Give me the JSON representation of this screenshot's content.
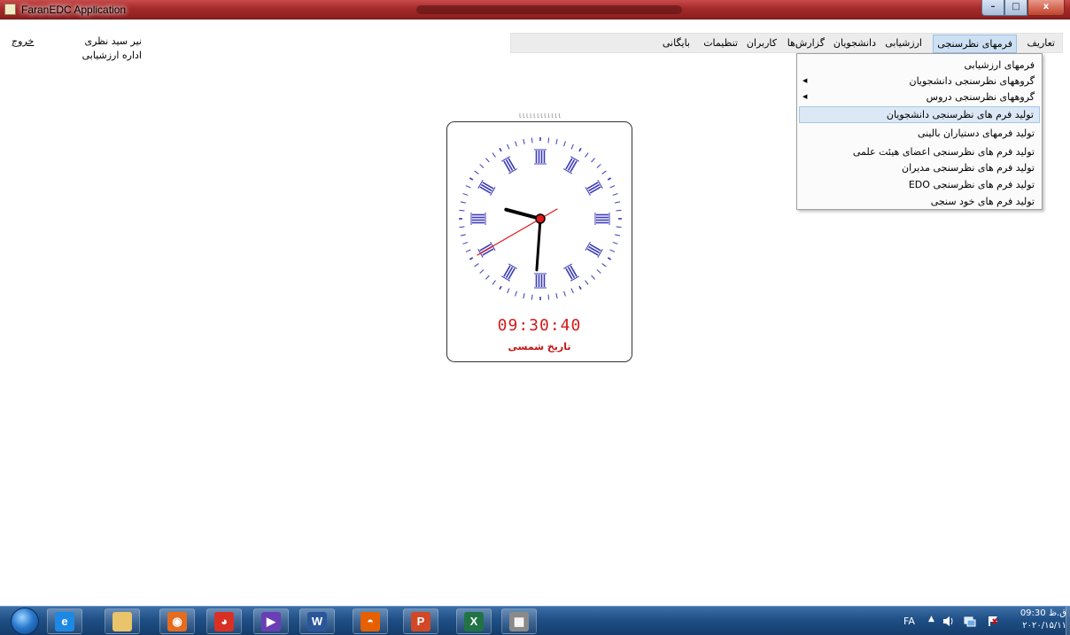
{
  "window": {
    "title": "FaranEDC Application",
    "buttons": {
      "minimize": "–",
      "maximize": "□",
      "close": "x"
    }
  },
  "user": {
    "logout": "خروج",
    "name": "نیر سید نظری",
    "department": "اداره ارزشیابی"
  },
  "menubar": {
    "items": [
      {
        "label": "تعاریف"
      },
      {
        "label": "فرمهای نظرسنجی",
        "active": true
      },
      {
        "label": "ارزشیابی"
      },
      {
        "label": "دانشجویان"
      },
      {
        "label": "گزارش‌ها"
      },
      {
        "label": "کاربران"
      },
      {
        "label": "تنظیمات"
      },
      {
        "label": "بایگانی"
      }
    ]
  },
  "dropdown": {
    "items": [
      {
        "label": "فرمهای ارزشیابی"
      },
      {
        "label": "گروههای نظرسنجی دانشجویان",
        "submenu": true
      },
      {
        "label": "گروههای نظرسنجی دروس",
        "submenu": true
      },
      {
        "label": "تولید فرم های نظرسنجی دانشجویان",
        "highlighted": true
      },
      {
        "label": "تولید فرمهای دستیاران بالینی"
      },
      {
        "label": "تولید فرم های نظرسنجی اعضای هیئت علمی"
      },
      {
        "label": "تولید فرم های نظرسنجی مدیران"
      },
      {
        "label": "تولید فرم های نظرسنجی EDO"
      },
      {
        "label": "تولید فرم های خود سنجی"
      }
    ]
  },
  "clock": {
    "digital_time": "09:30:40",
    "date_label": "تاریخ شمسی",
    "hands": {
      "hour": 9,
      "minute": 30,
      "second": 40
    },
    "hand_color": "#000000",
    "second_hand_color": "#e11919",
    "numeral_color": "#3b3bb8"
  },
  "taskbar": {
    "apps": [
      {
        "icon": "internet-explorer-icon",
        "glyph": "e",
        "color": "#1e88e5"
      },
      {
        "icon": "file-explorer-icon",
        "glyph": "",
        "color": "#e9c46a"
      },
      {
        "icon": "media-player-icon",
        "glyph": "◉",
        "color": "#e56b1f"
      },
      {
        "icon": "chrome-icon",
        "glyph": "◕",
        "color": "#d93025"
      },
      {
        "icon": "visual-studio-icon",
        "glyph": "▶",
        "color": "#6a3fb5"
      },
      {
        "icon": "word-icon",
        "glyph": "W",
        "color": "#2b579a"
      },
      {
        "icon": "firefox-icon",
        "glyph": "◓",
        "color": "#e66000"
      },
      {
        "icon": "powerpoint-icon",
        "glyph": "P",
        "color": "#d24726"
      },
      {
        "icon": "excel-icon",
        "glyph": "X",
        "color": "#217346"
      },
      {
        "icon": "faranedc-icon",
        "glyph": "▦",
        "color": "#8a8a8a"
      }
    ],
    "tray": {
      "language": "FA",
      "time": "09:30 ق.ظ",
      "date": "۲۰۲۰/۱۵/۱۱"
    }
  }
}
